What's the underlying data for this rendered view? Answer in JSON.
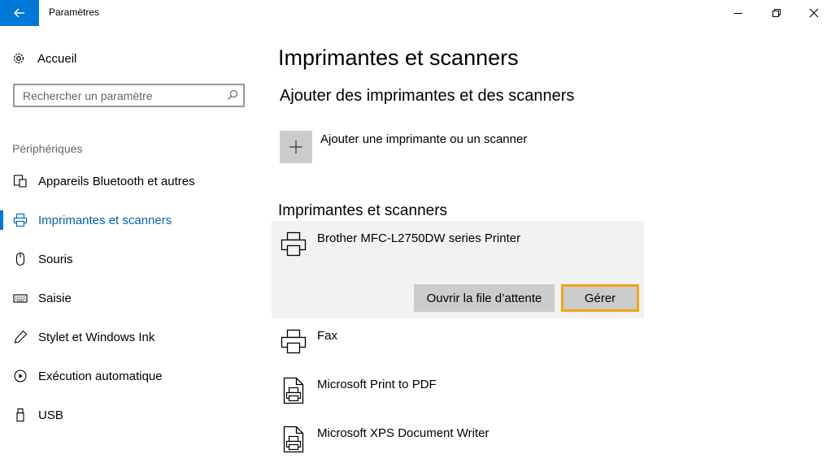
{
  "window": {
    "title": "Paramètres",
    "controls": [
      "minimize-icon",
      "restore-icon",
      "close-icon"
    ]
  },
  "sidebar": {
    "home_label": "Accueil",
    "search_placeholder": "Rechercher un paramètre",
    "section_title": "Périphériques",
    "items": [
      {
        "label": "Appareils Bluetooth et autres",
        "icon": "bluetooth-devices-icon",
        "active": false
      },
      {
        "label": "Imprimantes et scanners",
        "icon": "printer-icon",
        "active": true
      },
      {
        "label": "Souris",
        "icon": "mouse-icon",
        "active": false
      },
      {
        "label": "Saisie",
        "icon": "keyboard-icon",
        "active": false
      },
      {
        "label": "Stylet et Windows Ink",
        "icon": "pen-icon",
        "active": false
      },
      {
        "label": "Exécution automatique",
        "icon": "autoplay-icon",
        "active": false
      },
      {
        "label": "USB",
        "icon": "usb-icon",
        "active": false
      }
    ]
  },
  "main": {
    "title": "Imprimantes et scanners",
    "add_section_title": "Ajouter des imprimantes et des scanners",
    "add_label": "Ajouter une imprimante ou un scanner",
    "list_title": "Imprimantes et scanners",
    "devices": [
      {
        "name": "Brother MFC-L2750DW series Printer",
        "icon": "printer-icon",
        "selected": true
      },
      {
        "name": "Fax",
        "icon": "printer-icon",
        "selected": false
      },
      {
        "name": "Microsoft Print to PDF",
        "icon": "document-printer-icon",
        "selected": false
      },
      {
        "name": "Microsoft XPS Document Writer",
        "icon": "document-printer-icon",
        "selected": false
      }
    ],
    "buttons": {
      "open_queue": "Ouvrir la file d’attente",
      "manage": "Gérer"
    }
  },
  "colors": {
    "accent": "#0078d7",
    "focus_outline": "#f4a414",
    "selected_background": "#f2f2f2"
  }
}
